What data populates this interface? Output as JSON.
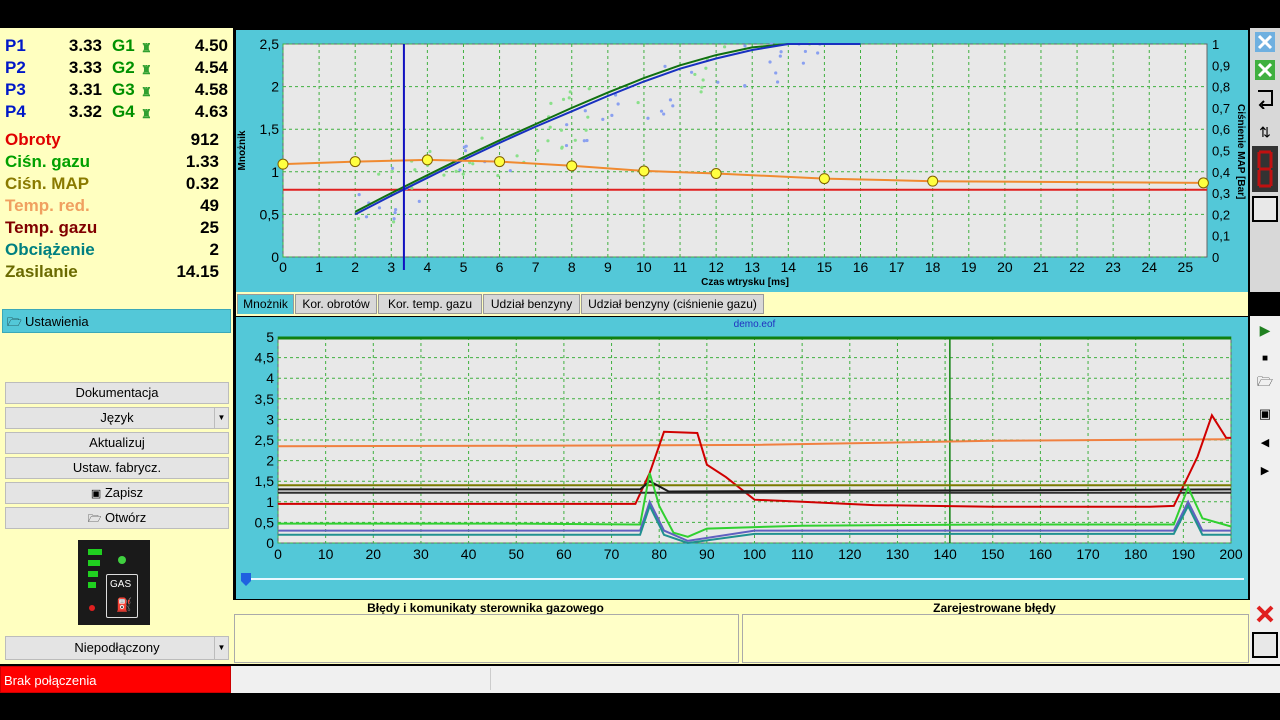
{
  "injectors": [
    {
      "p": "P1",
      "pv": "3.33",
      "g": "G1",
      "gv": "4.50"
    },
    {
      "p": "P2",
      "pv": "3.33",
      "g": "G2",
      "gv": "4.54"
    },
    {
      "p": "P3",
      "pv": "3.31",
      "g": "G3",
      "gv": "4.58"
    },
    {
      "p": "P4",
      "pv": "3.32",
      "g": "G4",
      "gv": "4.63"
    }
  ],
  "params": [
    {
      "label": "Obroty",
      "value": "912",
      "color": "#e00000"
    },
    {
      "label": "Ciśn. gazu",
      "value": "1.33",
      "color": "#00a000"
    },
    {
      "label": "Ciśn. MAP",
      "value": "0.32",
      "color": "#8a7a00"
    },
    {
      "label": "Temp. red.",
      "value": "49",
      "color": "#f0a060"
    },
    {
      "label": "Temp. gazu",
      "value": "25",
      "color": "#800000"
    },
    {
      "label": "Obciążenie",
      "value": "2",
      "color": "#008080"
    },
    {
      "label": "Zasilanie",
      "value": "14.15",
      "color": "#6a6a00"
    }
  ],
  "menu": {
    "settings": "Ustawienia",
    "docs": "Dokumentacja",
    "language": "Język",
    "update": "Aktualizuj",
    "factory": "Ustaw. fabrycz.",
    "save": "Zapisz",
    "open": "Otwórz",
    "gas_label": "GAS",
    "connection": "Niepodłączony"
  },
  "status": {
    "text": "Brak połączenia",
    "color": "#ff0000"
  },
  "tabs": [
    "Mnożnik",
    "Kor. obrotów",
    "Kor. temp. gazu",
    "Udział benzyny",
    "Udział benzyny (ciśnienie gazu)"
  ],
  "bottom_panel": {
    "left_title": "Błędy i komunikaty sterownika gazowego",
    "right_title": "Zarejestrowane błędy"
  },
  "top_chart": {
    "type": "line",
    "ylabel": "Mnożnik",
    "y2label": "Ciśnienie MAP [Bar]",
    "xlabel": "Czas wtrysku [ms]",
    "xlim": [
      0,
      25.6
    ],
    "ylim": [
      0,
      2.5
    ],
    "y2lim": [
      0,
      1
    ],
    "x_ticks": [
      0,
      1,
      2,
      3,
      4,
      5,
      6,
      7,
      8,
      9,
      10,
      11,
      12,
      13,
      14,
      15,
      16,
      17,
      18,
      19,
      20,
      21,
      22,
      23,
      24,
      25
    ],
    "y_ticks": [
      "0",
      "0,5",
      "1",
      "1,5",
      "2",
      "2,5"
    ],
    "y2_ticks": [
      "0",
      "0,1",
      "0,2",
      "0,3",
      "0,4",
      "0,5",
      "0,6",
      "0,7",
      "0,8",
      "0,9",
      "1"
    ],
    "cursor_x": 3.35,
    "red_line_y": 0.79,
    "multiplier_points": [
      {
        "x": 0,
        "y": 1.09
      },
      {
        "x": 2,
        "y": 1.12
      },
      {
        "x": 4,
        "y": 1.14
      },
      {
        "x": 6,
        "y": 1.12
      },
      {
        "x": 8,
        "y": 1.07
      },
      {
        "x": 10,
        "y": 1.01
      },
      {
        "x": 12,
        "y": 0.98
      },
      {
        "x": 15,
        "y": 0.92
      },
      {
        "x": 18,
        "y": 0.89
      },
      {
        "x": 25.5,
        "y": 0.87
      }
    ],
    "curve_dark_green": [
      [
        2,
        0.53
      ],
      [
        3,
        0.75
      ],
      [
        4,
        0.96
      ],
      [
        5,
        1.17
      ],
      [
        6,
        1.37
      ],
      [
        7,
        1.56
      ],
      [
        8,
        1.75
      ],
      [
        9,
        1.93
      ],
      [
        10,
        2.1
      ],
      [
        11,
        2.25
      ],
      [
        12,
        2.37
      ],
      [
        13,
        2.46
      ],
      [
        14,
        2.5
      ],
      [
        16,
        2.5
      ]
    ],
    "curve_blue": [
      [
        2,
        0.5
      ],
      [
        3,
        0.72
      ],
      [
        4,
        0.93
      ],
      [
        5,
        1.14
      ],
      [
        6,
        1.34
      ],
      [
        7,
        1.53
      ],
      [
        8,
        1.71
      ],
      [
        9,
        1.89
      ],
      [
        10,
        2.06
      ],
      [
        11,
        2.21
      ],
      [
        12,
        2.33
      ],
      [
        13,
        2.43
      ],
      [
        14,
        2.5
      ],
      [
        16,
        2.5
      ]
    ]
  },
  "bottom_chart": {
    "type": "line",
    "title": "demo.eof",
    "xlim": [
      0,
      200
    ],
    "ylim": [
      0,
      5
    ],
    "x_ticks": [
      0,
      10,
      20,
      30,
      40,
      50,
      60,
      70,
      80,
      90,
      100,
      110,
      120,
      130,
      140,
      150,
      160,
      170,
      180,
      190,
      200
    ],
    "y_ticks": [
      "0",
      "0,5",
      "1",
      "1,5",
      "2",
      "2,5",
      "3",
      "3,5",
      "4",
      "4,5",
      "5"
    ],
    "marker_x": 141,
    "series": [
      {
        "color": "#f08040",
        "values": [
          [
            0,
            2.35
          ],
          [
            50,
            2.36
          ],
          [
            100,
            2.38
          ],
          [
            150,
            2.48
          ],
          [
            199,
            2.52
          ]
        ]
      },
      {
        "color": "#d00000",
        "values": [
          [
            0,
            0.95
          ],
          [
            75,
            0.95
          ],
          [
            78,
            1.7
          ],
          [
            81,
            2.7
          ],
          [
            88,
            2.67
          ],
          [
            90,
            1.9
          ],
          [
            94,
            1.6
          ],
          [
            100,
            1.05
          ],
          [
            110,
            1.0
          ],
          [
            125,
            0.92
          ],
          [
            150,
            0.88
          ],
          [
            183,
            0.88
          ],
          [
            188,
            0.9
          ],
          [
            193,
            2.1
          ],
          [
            196,
            3.1
          ],
          [
            199,
            2.55
          ],
          [
            200,
            2.55
          ]
        ]
      },
      {
        "color": "#7a7a00",
        "values": [
          [
            0,
            1.4
          ],
          [
            76,
            1.4
          ],
          [
            80,
            1.4
          ],
          [
            88,
            1.4
          ],
          [
            200,
            1.4
          ]
        ]
      },
      {
        "color": "#303030",
        "values": [
          [
            0,
            1.22
          ],
          [
            200,
            1.22
          ]
        ]
      },
      {
        "color": "#1a1a1a",
        "values": [
          [
            0,
            1.3
          ],
          [
            76,
            1.3
          ],
          [
            78,
            1.5
          ],
          [
            82,
            1.25
          ],
          [
            200,
            1.3
          ]
        ]
      },
      {
        "color": "#30d030",
        "values": [
          [
            0,
            0.47
          ],
          [
            50,
            0.47
          ],
          [
            76,
            0.45
          ],
          [
            78,
            1.7
          ],
          [
            80,
            0.9
          ],
          [
            83,
            0.25
          ],
          [
            86,
            0.15
          ],
          [
            90,
            0.35
          ],
          [
            110,
            0.42
          ],
          [
            150,
            0.45
          ],
          [
            188,
            0.45
          ],
          [
            191,
            1.35
          ],
          [
            194,
            0.6
          ],
          [
            200,
            0.4
          ]
        ]
      },
      {
        "color": "#6060c0",
        "values": [
          [
            0,
            0.3
          ],
          [
            76,
            0.3
          ],
          [
            78,
            1.0
          ],
          [
            81,
            0.3
          ],
          [
            86,
            0.05
          ],
          [
            100,
            0.3
          ],
          [
            188,
            0.3
          ],
          [
            191,
            1.0
          ],
          [
            194,
            0.3
          ],
          [
            200,
            0.3
          ]
        ]
      },
      {
        "color": "#209090",
        "values": [
          [
            0,
            0.2
          ],
          [
            76,
            0.2
          ],
          [
            78,
            0.9
          ],
          [
            81,
            0.2
          ],
          [
            86,
            0.0
          ],
          [
            100,
            0.22
          ],
          [
            188,
            0.22
          ],
          [
            191,
            0.9
          ],
          [
            194,
            0.2
          ],
          [
            200,
            0.2
          ]
        ]
      }
    ]
  }
}
